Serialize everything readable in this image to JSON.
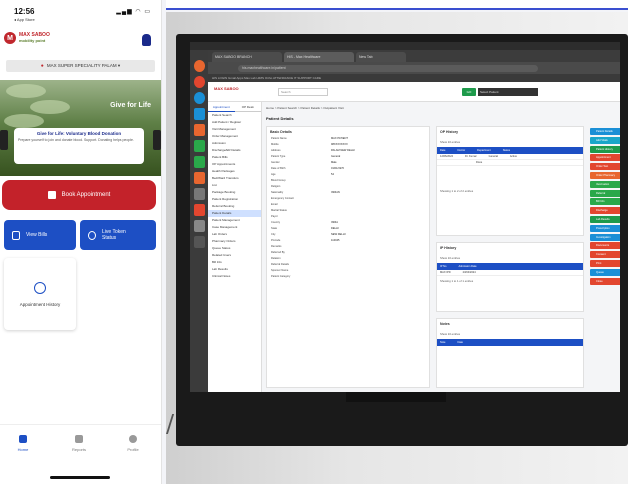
{
  "phone": {
    "status": {
      "time": "12:56",
      "carrier": "◂ App Store",
      "icons": "▂▄▆ ◠ ▭"
    },
    "brand": {
      "name": "MAX SABOO",
      "tagline": "mobility point"
    },
    "location": "MAX SUPER SPECIALITY PALAM ▾",
    "banner": {
      "title_line1": "Give for Life",
      "title_line2": "",
      "card_title": "Give for Life: Voluntary Blood Donation",
      "card_text": "Prepare yourself to join and donate blood. Support. Donating helps people."
    },
    "actions": {
      "book": "Book Appointment",
      "bills": "View Bills",
      "tokens_line1": "Live Token",
      "tokens_line2": "Status",
      "history": "Appointment History"
    },
    "nav": {
      "home": "Home",
      "reports": "Reports",
      "profile": "Profile"
    }
  },
  "monitor": {
    "browser_tabs": [
      "MAX SABOO BRANCH",
      "HIS - Max Healthcare",
      "New Tab"
    ],
    "url": "his.maxhealthcare.in/patient",
    "bookmarks": "HIS LOGIN   Gmail   Apps   Max Lab   HIMS   Ortho   ATTENDANCE   IT SUPPORT   CARE",
    "app": {
      "logo": "MAX SABOO",
      "search_placeholder": "Search",
      "go": "GO",
      "select": "Select Patient"
    },
    "sidemenu": {
      "tabs": [
        "Appointment",
        "OP Desk"
      ],
      "items": [
        "Patient Search",
        "Add Patient / Register",
        "Visit Management",
        "Order Management",
        "Admission",
        "Discharge/ER Details",
        "Patient Bills",
        "OP Appointments",
        "Health Packages",
        "Bed/Ward Transfers",
        "List",
        "Package Booking",
        "Patient Registration",
        "Referral Booking",
        "Patient Details",
        "Patient Management",
        "Case Management",
        "Lab Orders",
        "Pharmacy Orders",
        "Queue Status",
        "Related Users",
        "Bill Info",
        "Lab Results",
        "Clinical Notes"
      ]
    },
    "breadcrumb": "Home > Patient Search > Patient Details > Outpatient Visit",
    "page_title": "Patient Details",
    "basic_details": {
      "title": "Basic Details",
      "rows": [
        [
          "Patient Name",
          "MAX PATIENT"
        ],
        [
          "Mobile",
          "98XXXXXXXX"
        ],
        [
          "Address",
          "PALAM NEW DELHI"
        ],
        [
          "Patient Type",
          "General"
        ],
        [
          "Gender",
          "Male"
        ],
        [
          "Date of Birth",
          "01/01/1970"
        ],
        [
          "Age",
          "54"
        ],
        [
          "Blood Group",
          ""
        ],
        [
          "Religion",
          ""
        ],
        [
          "Nationality",
          "INDIAN"
        ],
        [
          "Emergency Contact",
          ""
        ],
        [
          "Email",
          ""
        ],
        [
          "Marital Status",
          ""
        ],
        [
          "Payor",
          ""
        ],
        [
          "Country",
          "INDIA"
        ],
        [
          "State",
          "DELHI"
        ],
        [
          "City",
          "NEW DELHI"
        ],
        [
          "Pincode",
          "110045"
        ],
        [
          "Remarks",
          ""
        ],
        [
          "Referred By",
          ""
        ],
        [
          "Relation",
          ""
        ],
        [
          "Referral Details",
          ""
        ],
        [
          "Sponsor Name",
          ""
        ],
        [
          "Patient Category",
          ""
        ]
      ]
    },
    "visits_panel": {
      "title": "OP History",
      "show": "Show 10 entries",
      "headers": [
        "Date",
        "Doctor",
        "Department",
        "Status"
      ],
      "rows": [
        [
          "12/06/2024",
          "Dr. Kumar",
          "General",
          "Active"
        ],
        [
          "",
          "",
          "",
          "Done"
        ]
      ],
      "footer": "Showing 1 to 2 of 2 entries"
    },
    "ip_panel": {
      "title": "IP History",
      "show": "Show 10 entries",
      "headers": [
        "IP No",
        "Admission Date"
      ],
      "rows": [
        [
          "MAX IPD",
          "23/04/2024"
        ]
      ],
      "footer": "Showing 1 to 1 of 1 entries"
    },
    "notes_panel": {
      "title": "Notes",
      "show": "Show 10 entries",
      "headers": [
        "Note",
        "Date"
      ]
    },
    "right_buttons": [
      {
        "label": "Patient Details",
        "color": "#1a8fd6"
      },
      {
        "label": "Add Vitals",
        "color": "#1aa6c9"
      },
      {
        "label": "Patient History",
        "color": "#1e9a4b"
      },
      {
        "label": "Appointment",
        "color": "#e2462f"
      },
      {
        "label": "Order Test",
        "color": "#e2462f"
      },
      {
        "label": "Order Pharmacy",
        "color": "#e8662f"
      },
      {
        "label": "Vaccination",
        "color": "#2aa84a"
      },
      {
        "label": "Referral",
        "color": "#2aa84a"
      },
      {
        "label": "Bill Info",
        "color": "#2aa84a"
      },
      {
        "label": "Discharge",
        "color": "#e2462f"
      },
      {
        "label": "Lab Results",
        "color": "#1e9a4b"
      },
      {
        "label": "Prescription",
        "color": "#1a8fd6"
      },
      {
        "label": "Investigation",
        "color": "#1a8fd6"
      },
      {
        "label": "Documents",
        "color": "#e2462f"
      },
      {
        "label": "Consent",
        "color": "#e2462f"
      },
      {
        "label": "Print",
        "color": "#e2462f"
      },
      {
        "label": "Queue",
        "color": "#1a8fd6"
      },
      {
        "label": "Close",
        "color": "#e2462f"
      }
    ]
  }
}
